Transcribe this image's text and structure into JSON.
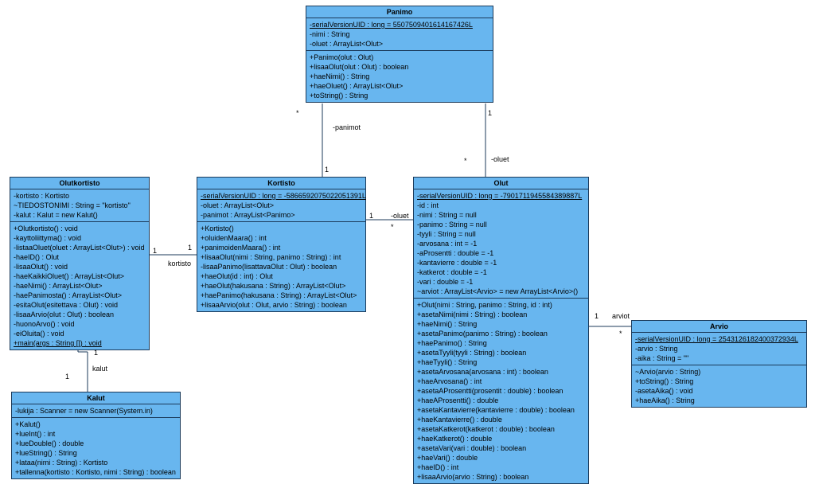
{
  "classes": {
    "panimo": {
      "name": "Panimo",
      "attrs": [
        {
          "text": "-serialVersionUID : long = 5507509401614167426L",
          "underline": true
        },
        {
          "text": "-nimi : String"
        },
        {
          "text": "-oluet : ArrayList<Olut>"
        }
      ],
      "ops": [
        {
          "text": "+Panimo(olut : Olut)"
        },
        {
          "text": "+lisaaOlut(olut : Olut) : boolean"
        },
        {
          "text": "+haeNimi() : String"
        },
        {
          "text": "+haeOluet() : ArrayList<Olut>"
        },
        {
          "text": "+toString() : String"
        }
      ]
    },
    "olutkortisto": {
      "name": "Olutkortisto",
      "attrs": [
        {
          "text": "-kortisto : Kortisto"
        },
        {
          "text": "~TIEDOSTONIMI : String = \"kortisto\""
        },
        {
          "text": "-kalut : Kalut = new Kalut()"
        }
      ],
      "ops": [
        {
          "text": "+Olutkortisto() : void"
        },
        {
          "text": "-kayttoliittyma() : void"
        },
        {
          "text": "-listaaOluet(oluet : ArrayList<Olut>) : void"
        },
        {
          "text": "-haeID() : Olut"
        },
        {
          "text": "-lisaaOlut() : void"
        },
        {
          "text": "-haeKaikkiOluet() : ArrayList<Olut>"
        },
        {
          "text": "-haeNimi() : ArrayList<Olut>"
        },
        {
          "text": "-haePanimosta() : ArrayList<Olut>"
        },
        {
          "text": "-esitaOlut(esitettava : Olut) : void"
        },
        {
          "text": "-lisaaArvio(olut : Olut) : boolean"
        },
        {
          "text": "-huonoArvo() : void"
        },
        {
          "text": "-eiOluita() : void"
        },
        {
          "text": "+main(args : String []) : void",
          "underline": true
        }
      ]
    },
    "kortisto": {
      "name": "Kortisto",
      "attrs": [
        {
          "text": "-serialVersionUID : long = -5866592075022051391L",
          "underline": true
        },
        {
          "text": "-oluet : ArrayList<Olut>"
        },
        {
          "text": "-panimot : ArrayList<Panimo>"
        }
      ],
      "ops": [
        {
          "text": "+Kortisto()"
        },
        {
          "text": "+oluidenMaara() : int"
        },
        {
          "text": "+panimoidenMaara() : int"
        },
        {
          "text": "+lisaaOlut(nimi : String, panimo : String) : int"
        },
        {
          "text": "-lisaaPanimo(lisattavaOlut : Olut) : boolean"
        },
        {
          "text": "+haeOlut(id : int) : Olut"
        },
        {
          "text": "+haeOlut(hakusana : String) : ArrayList<Olut>"
        },
        {
          "text": "+haePanimo(hakusana : String) : ArrayList<Olut>"
        },
        {
          "text": "+lisaaArvio(olut : Olut, arvio : String) : boolean"
        }
      ]
    },
    "olut": {
      "name": "Olut",
      "attrs": [
        {
          "text": "-serialVersionUID : long = -7901711945584389887L",
          "underline": true
        },
        {
          "text": "-id : int"
        },
        {
          "text": "-nimi : String = null"
        },
        {
          "text": "-panimo : String = null"
        },
        {
          "text": "-tyyli : String = null"
        },
        {
          "text": "-arvosana : int = -1"
        },
        {
          "text": "-aProsentti : double = -1"
        },
        {
          "text": "-kantavierre : double = -1"
        },
        {
          "text": "-katkerot : double = -1"
        },
        {
          "text": "-vari : double = -1"
        },
        {
          "text": "~arviot : ArrayList<Arvio> = new ArrayList<Arvio>()"
        }
      ],
      "ops": [
        {
          "text": "+Olut(nimi : String, panimo : String, id : int)"
        },
        {
          "text": "+asetaNimi(nimi : String) : boolean"
        },
        {
          "text": "+haeNimi() : String"
        },
        {
          "text": "+asetaPanimo(panimo : String) : boolean"
        },
        {
          "text": "+haePanimo() : String"
        },
        {
          "text": "+asetaTyyli(tyyli : String) : boolean"
        },
        {
          "text": "+haeTyyli() : String"
        },
        {
          "text": "+asetaArvosana(arvosana : int) : boolean"
        },
        {
          "text": "+haeArvosana() : int"
        },
        {
          "text": "+asetaAProsentti(prosentit : double) : boolean"
        },
        {
          "text": "+haeAProsentti() : double"
        },
        {
          "text": "+asetaKantavierre(kantavierre : double) : boolean"
        },
        {
          "text": "+haeKantavierre() : double"
        },
        {
          "text": "+asetaKatkerot(katkerot : double) : boolean"
        },
        {
          "text": "+haeKatkerot() : double"
        },
        {
          "text": "+asetaVari(vari : double) : boolean"
        },
        {
          "text": "+haeVari() : double"
        },
        {
          "text": "+haeID() : int"
        },
        {
          "text": "+lisaaArvio(arvio : String) : boolean"
        }
      ]
    },
    "arvio": {
      "name": "Arvio",
      "attrs": [
        {
          "text": "-serialVersionUID : long = 2543126182400372934L",
          "underline": true
        },
        {
          "text": "-arvio : String"
        },
        {
          "text": "-aika : String = \"\""
        }
      ],
      "ops": [
        {
          "text": "~Arvio(arvio : String)"
        },
        {
          "text": "+toString() : String"
        },
        {
          "text": "-asetaAika() : void"
        },
        {
          "text": "+haeAika() : String"
        }
      ]
    },
    "kalut": {
      "name": "Kalut",
      "attrs": [
        {
          "text": "-lukija : Scanner = new Scanner(System.in)"
        }
      ],
      "ops": [
        {
          "text": "+Kalut()"
        },
        {
          "text": "+lueInt() : int"
        },
        {
          "text": "+lueDouble() : double"
        },
        {
          "text": "+lueString() : String"
        },
        {
          "text": "+lataa(nimi : String) : Kortisto"
        },
        {
          "text": "+tallenna(kortisto : Kortisto, nimi : String) : boolean"
        }
      ]
    }
  },
  "assocLabels": {
    "panimo_kortisto_role": "-panimot",
    "panimo_kortisto_m1": "*",
    "panimo_kortisto_m2": "1",
    "panimo_olut_role": "-oluet",
    "panimo_olut_m1": "1",
    "panimo_olut_m2": "*",
    "kortisto_olut_role": "-oluet",
    "kortisto_olut_m1": "1",
    "kortisto_olut_m2": "*",
    "olutkortisto_kortisto_role": "kortisto",
    "olutkortisto_kortisto_m1": "1",
    "olutkortisto_kortisto_m2": "1",
    "olutkortisto_kalut_role": "kalut",
    "olutkortisto_kalut_m1": "1",
    "olutkortisto_kalut_m2": "1",
    "olut_arvio_role": "arviot",
    "olut_arvio_m1": "1",
    "olut_arvio_m2": "*"
  }
}
